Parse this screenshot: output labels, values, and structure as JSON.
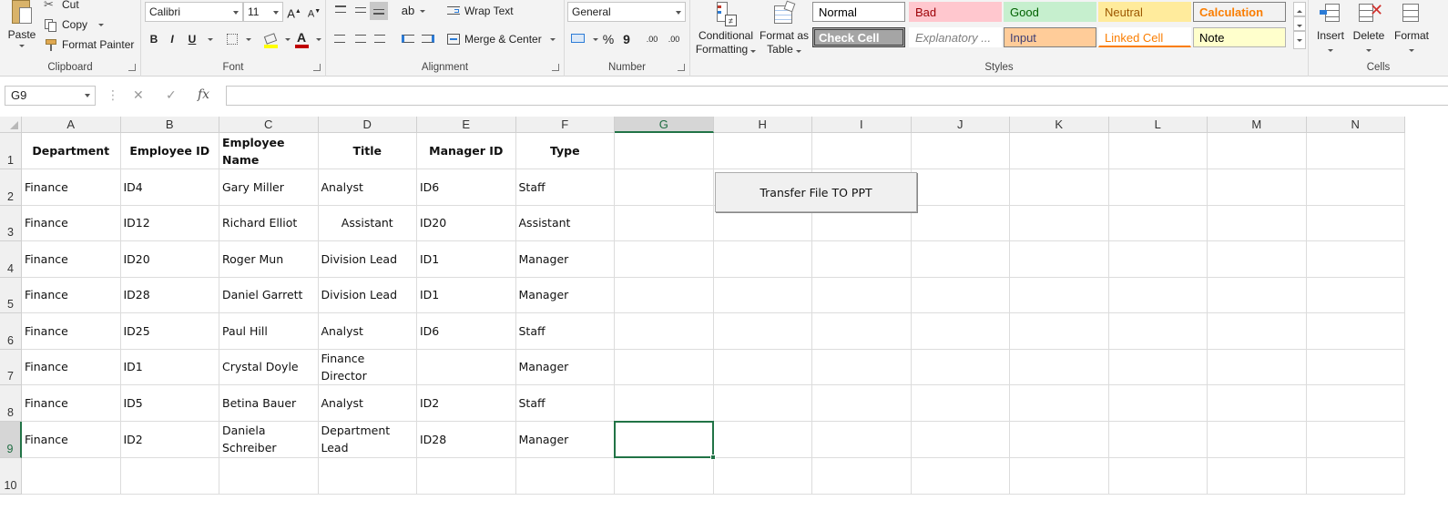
{
  "ribbon": {
    "clipboard": {
      "label": "Clipboard",
      "paste": "Paste",
      "cut": "Cut",
      "copy": "Copy",
      "format_painter": "Format Painter"
    },
    "font": {
      "label": "Font",
      "font_name": "Calibri",
      "font_size": "11",
      "grow": "A",
      "shrink": "A",
      "bold": "B",
      "italic": "I",
      "underline": "U",
      "font_color_letter": "A",
      "font_color": "#c00000",
      "highlight_color": "#ffff00"
    },
    "alignment": {
      "label": "Alignment",
      "wrap_text": "Wrap Text",
      "merge_center": "Merge & Center"
    },
    "number": {
      "label": "Number",
      "format": "General",
      "percent": "%",
      "comma": "9",
      "inc_decimal": ".00",
      "dec_decimal": ".00"
    },
    "styles": {
      "label": "Styles",
      "conditional_formatting": [
        "Conditional",
        "Formatting"
      ],
      "format_as_table": [
        "Format as",
        "Table"
      ],
      "gallery": [
        {
          "text": "Normal",
          "bg": "#ffffff",
          "color": "#000000",
          "border": "#8e8e8e"
        },
        {
          "text": "Bad",
          "bg": "#ffc7ce",
          "color": "#9c0006",
          "border": "#ffc7ce"
        },
        {
          "text": "Good",
          "bg": "#c6efce",
          "color": "#006100",
          "border": "#c6efce"
        },
        {
          "text": "Neutral",
          "bg": "#ffeb9c",
          "color": "#9c5700",
          "border": "#ffeb9c"
        },
        {
          "text": "Calculation",
          "bg": "#f2f2f2",
          "color": "#fa7d00",
          "border": "#7f7f7f"
        },
        {
          "text": "Check Cell",
          "bg": "#a5a5a5",
          "color": "#ffffff",
          "border": "#3f3f3f"
        },
        {
          "text": "Explanatory ...",
          "bg": "#ffffff",
          "color": "#7f7f7f",
          "border": "#ffffff"
        },
        {
          "text": "Input",
          "bg": "#ffcc99",
          "color": "#3f3f76",
          "border": "#7f7f7f"
        },
        {
          "text": "Linked Cell",
          "bg": "#ffffff",
          "color": "#fa7d00",
          "border": "#ffffff"
        },
        {
          "text": "Note",
          "bg": "#ffffcc",
          "color": "#000000",
          "border": "#b2b2b2"
        }
      ]
    },
    "cells": {
      "label": "Cells",
      "insert": "Insert",
      "delete": "Delete",
      "format": "Format"
    }
  },
  "formula_bar": {
    "name_box": "G9",
    "cancel": "✕",
    "enter": "✓",
    "fx": "fx",
    "value": ""
  },
  "sheet": {
    "columns": [
      "A",
      "B",
      "C",
      "D",
      "E",
      "F",
      "G",
      "H",
      "I",
      "J",
      "K",
      "L",
      "M",
      "N"
    ],
    "selected_column": "G",
    "selected_row": "9",
    "rows": [
      "1",
      "2",
      "3",
      "4",
      "5",
      "6",
      "7",
      "8",
      "9",
      "10"
    ],
    "headers": [
      "Department",
      "Employee ID",
      "Employee Name",
      "Title",
      "Manager ID",
      "Type"
    ],
    "data": [
      [
        "Finance",
        "ID4",
        "Gary Miller",
        "Analyst",
        "ID6",
        "Staff"
      ],
      [
        "Finance",
        "ID12",
        "Richard Elliot",
        "Assistant",
        "ID20",
        "Assistant"
      ],
      [
        "Finance",
        "ID20",
        "Roger Mun",
        "Division Lead",
        "ID1",
        "Manager"
      ],
      [
        "Finance",
        "ID28",
        "Daniel Garrett",
        "Division Lead",
        "ID1",
        "Manager"
      ],
      [
        "Finance",
        "ID25",
        "Paul Hill",
        "Analyst",
        "ID6",
        "Staff"
      ],
      [
        "Finance",
        "ID1",
        "Crystal Doyle",
        "Finance Director",
        "",
        "Manager"
      ],
      [
        "Finance",
        "ID5",
        "Betina Bauer",
        "Analyst",
        "ID2",
        "Staff"
      ],
      [
        "Finance",
        "ID2",
        "Daniela Schreiber",
        "Department Lead",
        "ID28",
        "Manager"
      ]
    ],
    "centered_cells": [
      "1.3"
    ],
    "accent_color": "#217346"
  },
  "transfer_button": {
    "label": "Transfer File TO PPT"
  }
}
